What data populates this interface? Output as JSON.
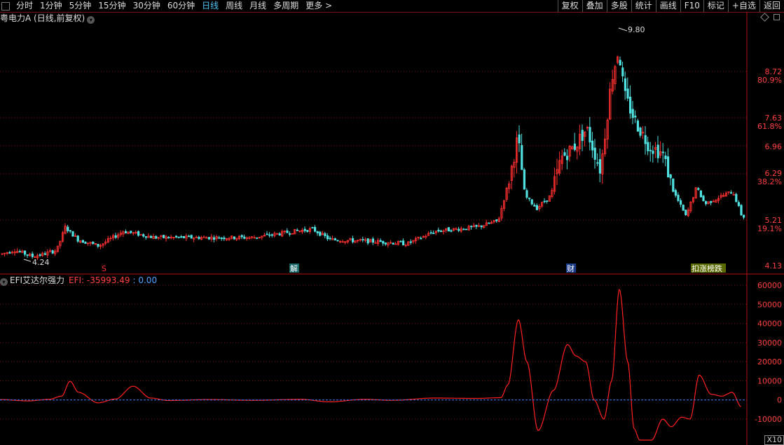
{
  "toolbar": {
    "periods": [
      "分时",
      "1分钟",
      "5分钟",
      "15分钟",
      "30分钟",
      "60分钟",
      "日线",
      "周线",
      "月线",
      "多周期",
      "更多 >"
    ],
    "active_period": "日线",
    "right_buttons": [
      "复权",
      "叠加",
      "多股",
      "统计",
      "画线",
      "F10",
      "标记",
      "+自选",
      "返回"
    ]
  },
  "title": "粤电力A (日线,前复权)",
  "price_axis": {
    "labels": [
      {
        "value": "8.72",
        "pct": "80.9%"
      },
      {
        "value": "7.63",
        "pct": "61.8%"
      },
      {
        "value": "6.96",
        "pct": ""
      },
      {
        "value": "6.29",
        "pct": "38.2%"
      },
      {
        "value": "5.21",
        "pct": "19.1%"
      },
      {
        "value": "4.13",
        "pct": ""
      }
    ]
  },
  "annotations": {
    "high": "9.80",
    "low": "4.24",
    "markers": [
      "S",
      "解",
      "财",
      "扣涨榜跌"
    ]
  },
  "indicator": {
    "name": "EFI艾达尔强力",
    "efi_label": "EFI: -35993.49",
    "zero_label": ": 0.00",
    "axis": [
      "60000",
      "50000",
      "40000",
      "30000",
      "20000",
      "10000",
      "0",
      "-10000"
    ],
    "multiplier": "X10"
  },
  "colors": {
    "up": "#ff3030",
    "down": "#50e0e0",
    "grid": "#7a1010",
    "efi": "#ff2020",
    "zero": "#3f7fff"
  }
}
